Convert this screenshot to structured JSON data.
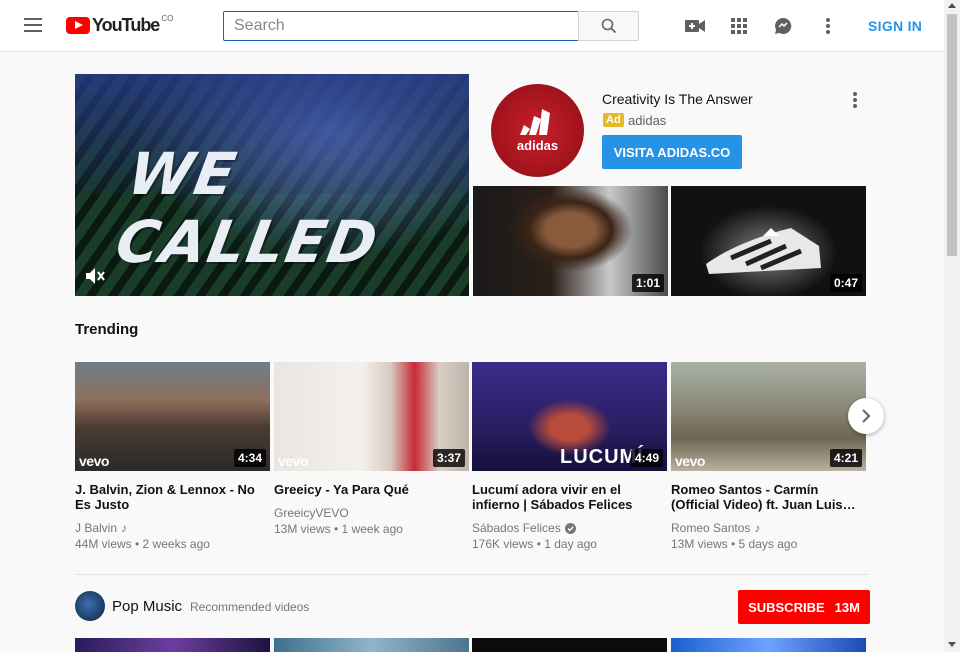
{
  "header": {
    "logo_text": "YouTube",
    "logo_country": "CO",
    "search_placeholder": "Search",
    "signin_label": "SIGN IN",
    "icons": [
      "menu-icon",
      "search-icon",
      "upload-video-icon",
      "apps-icon",
      "messages-icon",
      "more-icon"
    ]
  },
  "ad": {
    "hero_text": "WE CALLED",
    "logo_text": "adidas",
    "title": "Creativity Is The Answer",
    "badge": "Ad",
    "advertiser": "adidas",
    "cta": "VISITA ADIDAS.CO",
    "thumbs": [
      {
        "duration": "1:01"
      },
      {
        "duration": "0:47"
      }
    ]
  },
  "trending": {
    "title": "Trending",
    "videos": [
      {
        "title": "J. Balvin, Zion & Lennox - No Es Justo",
        "channel": "J Balvin",
        "meta": "44M views • 2 weeks ago",
        "duration": "4:34",
        "vevo": "vevo",
        "channel_badge": "music-note"
      },
      {
        "title": "Greeicy - Ya Para Qué",
        "channel": "GreeicyVEVO",
        "meta": "13M views • 1 week ago",
        "duration": "3:37",
        "vevo": "vevo",
        "channel_badge": ""
      },
      {
        "title": "Lucumí adora vivir en el infierno | Sábados Felices",
        "channel": "Sábados Felices",
        "meta": "176K views • 1 day ago",
        "duration": "4:49",
        "overlay_text": "LUCUMÍ",
        "channel_badge": "verified"
      },
      {
        "title": "Romeo Santos - Carmín (Official Video) ft. Juan Luis…",
        "channel": "Romeo Santos",
        "meta": "13M views • 5 days ago",
        "duration": "4:21",
        "vevo": "vevo",
        "channel_badge": "music-note"
      }
    ]
  },
  "shelf": {
    "title": "Pop Music",
    "subtitle": "Recommended videos",
    "subscribe_label": "SUBSCRIBE",
    "subscriber_count": "13M"
  },
  "colors": {
    "brand_red": "#ff0000",
    "link_blue": "#2793e6",
    "ad_yellow": "#e6b82c"
  }
}
